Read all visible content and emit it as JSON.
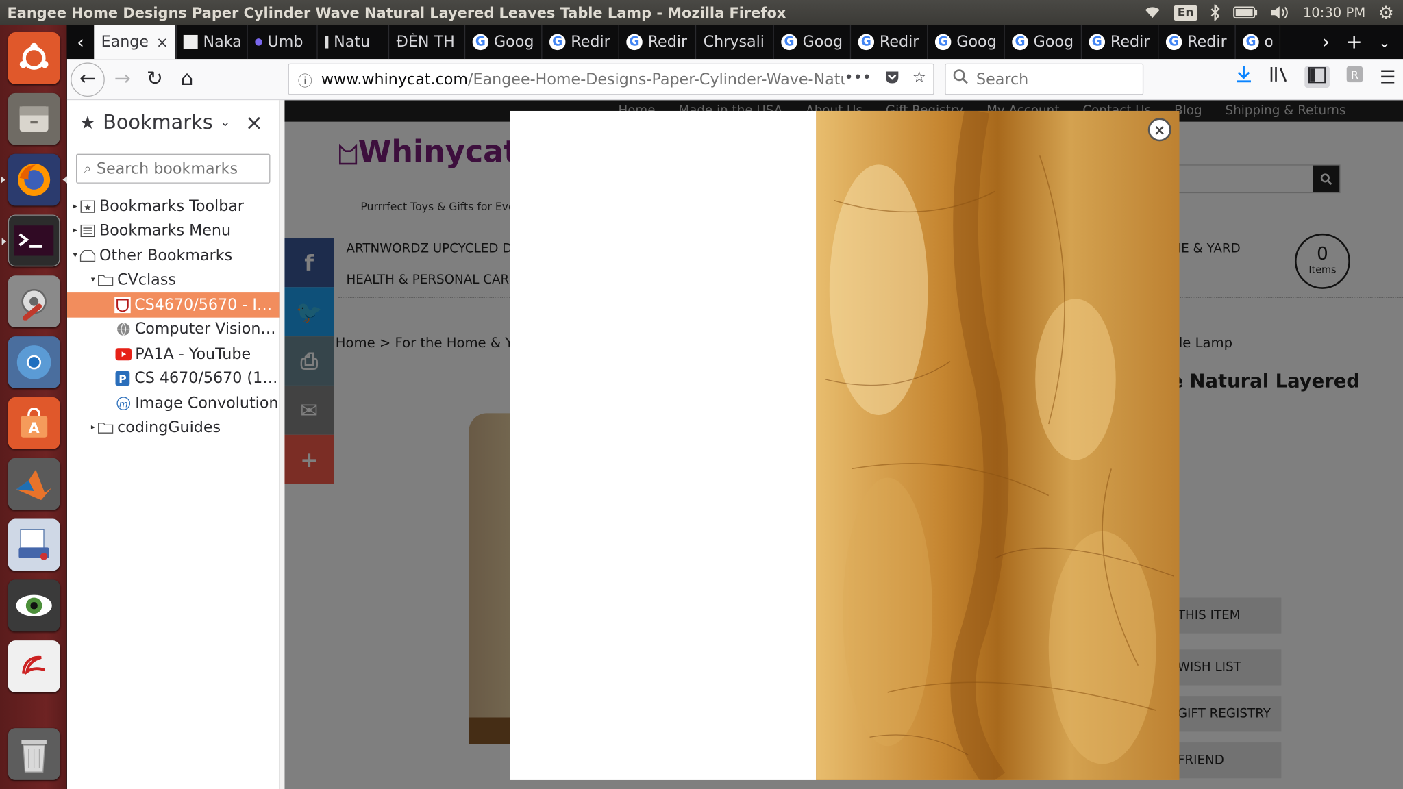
{
  "window": {
    "title": "Eangee Home Designs Paper Cylinder Wave Natural Layered Leaves Table Lamp - Mozilla Firefox"
  },
  "tray": {
    "keyboard": "En",
    "time": "10:30 PM"
  },
  "launcher": {
    "apps": [
      "ubuntu-dash",
      "files",
      "firefox",
      "terminal",
      "system-settings",
      "chromium",
      "software-center",
      "matlab",
      "scanner",
      "eye-of-gnome",
      "pdf-reader",
      "trash"
    ]
  },
  "tabs": [
    {
      "label": "Eange",
      "fav": "none",
      "active": true
    },
    {
      "label": "Naka",
      "fav": "redlist"
    },
    {
      "label": "Umb",
      "fav": "dot"
    },
    {
      "label": "Natu",
      "fav": "bar"
    },
    {
      "label": "ĐÈN TH",
      "fav": "none"
    },
    {
      "label": "Goog",
      "fav": "google"
    },
    {
      "label": "Redir",
      "fav": "google"
    },
    {
      "label": "Redir",
      "fav": "google"
    },
    {
      "label": "Chrysali",
      "fav": "none"
    },
    {
      "label": "Goog",
      "fav": "google"
    },
    {
      "label": "Redir",
      "fav": "google"
    },
    {
      "label": "Goog",
      "fav": "google"
    },
    {
      "label": "Goog",
      "fav": "google"
    },
    {
      "label": "Redir",
      "fav": "google"
    },
    {
      "label": "Redir",
      "fav": "google"
    },
    {
      "label": "o",
      "fav": "google"
    }
  ],
  "navbar": {
    "url_domain": "www.whinycat.com",
    "url_path": "/Eangee-Home-Designs-Paper-Cylinder-Wave-Natura",
    "search_placeholder": "Search"
  },
  "sidebar": {
    "title": "Bookmarks",
    "search_placeholder": "Search bookmarks",
    "items": [
      {
        "label": "Bookmarks Toolbar",
        "level": 0,
        "twisty": "▸",
        "icon": "toolbar"
      },
      {
        "label": "Bookmarks Menu",
        "level": 0,
        "twisty": "▸",
        "icon": "menu"
      },
      {
        "label": "Other Bookmarks",
        "level": 0,
        "twisty": "▾",
        "icon": "other"
      },
      {
        "label": "CVclass",
        "level": 1,
        "twisty": "▾",
        "icon": "folder"
      },
      {
        "label": "CS4670/5670 - Intr...",
        "level": 2,
        "twisty": "",
        "icon": "shield",
        "selected": true
      },
      {
        "label": "Computer Vision: ...",
        "level": 2,
        "twisty": "",
        "icon": "globe"
      },
      {
        "label": "PA1A - YouTube",
        "level": 2,
        "twisty": "",
        "icon": "youtube"
      },
      {
        "label": "CS 4670/5670 (11 ...",
        "level": 2,
        "twisty": "",
        "icon": "p"
      },
      {
        "label": "Image Convolution",
        "level": 2,
        "twisty": "",
        "icon": "m"
      },
      {
        "label": "codingGuides",
        "level": 1,
        "twisty": "▸",
        "icon": "folder"
      }
    ]
  },
  "site": {
    "topnav": [
      "Home",
      "Made in the USA",
      "About Us",
      "Gift Registry",
      "My Account",
      "Contact Us",
      "Blog",
      "Shipping & Returns"
    ],
    "logo": "Whinycat.c",
    "tagline": "Purrrfect Toys & Gifts for Eve",
    "menu1": "ARTNWORDZ UPCYCLED DIC",
    "menu1_right": "ME & YARD",
    "menu2": "HEALTH & PERSONAL CARE",
    "cart_count": "0",
    "cart_label": "Items",
    "breadcrumb_left": "Home > For the Home & Yar",
    "breadcrumb_right": "ble Lamp",
    "title_fragment": "e Natural Layered",
    "buttons": [
      "THIS ITEM",
      "WISH LIST",
      "GIFT REGISTRY",
      "FRIEND"
    ],
    "share": [
      {
        "name": "facebook",
        "glyph": "f",
        "color": "#3b5998"
      },
      {
        "name": "twitter",
        "glyph": "🐦",
        "color": "#1da1f2"
      },
      {
        "name": "print",
        "glyph": "⎙",
        "color": "#6d8a96"
      },
      {
        "name": "email",
        "glyph": "✉",
        "color": "#848484"
      },
      {
        "name": "more",
        "glyph": "+",
        "color": "#f65a4b"
      }
    ]
  },
  "modal": {
    "close_glyph": "×"
  },
  "colors": {
    "tab_bar": "#0c0c0d",
    "selected_bookmark": "#f28d5d",
    "launcher": "#6e2323"
  }
}
